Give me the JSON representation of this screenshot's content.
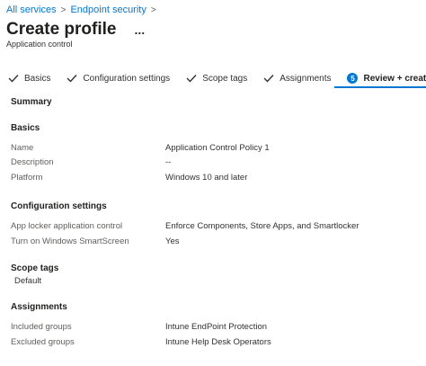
{
  "breadcrumb": {
    "items": [
      "All services",
      "Endpoint security"
    ],
    "separator": ">"
  },
  "header": {
    "title": "Create profile",
    "more": "...",
    "subtitle": "Application control"
  },
  "steps": [
    {
      "label": "Basics",
      "state": "done"
    },
    {
      "label": "Configuration settings",
      "state": "done"
    },
    {
      "label": "Scope tags",
      "state": "done"
    },
    {
      "label": "Assignments",
      "state": "done"
    },
    {
      "label": "Review + create",
      "state": "current",
      "number": "5"
    }
  ],
  "summary": {
    "heading": "Summary",
    "basics": {
      "heading": "Basics",
      "rows": [
        {
          "label": "Name",
          "value": "Application Control Policy 1"
        },
        {
          "label": "Description",
          "value": "--"
        },
        {
          "label": "Platform",
          "value": "Windows 10 and later"
        }
      ]
    },
    "configuration": {
      "heading": "Configuration settings",
      "rows": [
        {
          "label": "App locker application control",
          "value": "Enforce Components, Store Apps, and Smartlocker"
        },
        {
          "label": "Turn on Windows SmartScreen",
          "value": "Yes"
        }
      ]
    },
    "scope_tags": {
      "heading": "Scope tags",
      "value": "Default"
    },
    "assignments": {
      "heading": "Assignments",
      "rows": [
        {
          "label": "Included groups",
          "value": "Intune EndPoint Protection"
        },
        {
          "label": "Excluded groups",
          "value": "Intune Help Desk Operators"
        }
      ]
    }
  },
  "colors": {
    "accent": "#0078d4",
    "text": "#323130",
    "muted": "#605e5c"
  },
  "icons": {
    "completed_step": "checkmark-icon",
    "breadcrumb_separator": "chevron-right-icon",
    "more": "more-options-icon"
  }
}
